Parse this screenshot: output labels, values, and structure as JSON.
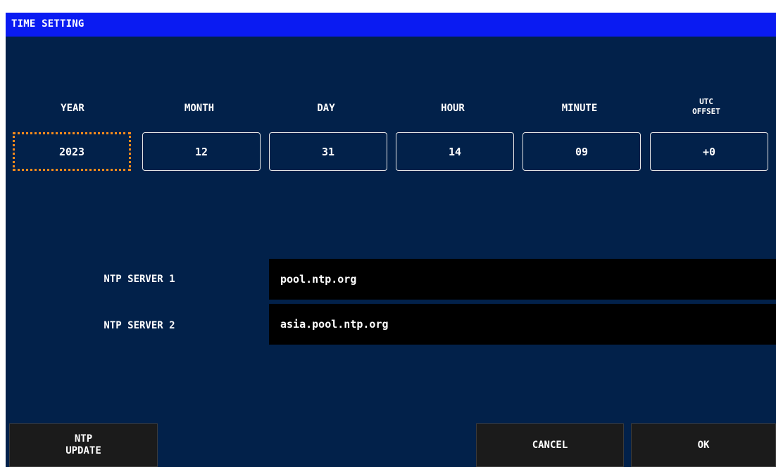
{
  "window": {
    "title": "TIME SETTING"
  },
  "fields": [
    {
      "label": "YEAR",
      "value": "2023"
    },
    {
      "label": "MONTH",
      "value": "12"
    },
    {
      "label": "DAY",
      "value": "31"
    },
    {
      "label": "HOUR",
      "value": "14"
    },
    {
      "label": "MINUTE",
      "value": "09"
    },
    {
      "label_line1": "UTC",
      "label_line2": "OFFSET",
      "value": "+0"
    }
  ],
  "ntp": {
    "server1_label": "NTP SERVER 1",
    "server1_value": "pool.ntp.org",
    "server2_label": "NTP SERVER 2",
    "server2_value": "asia.pool.ntp.org"
  },
  "buttons": {
    "ntp_update_line1": "NTP",
    "ntp_update_line2": "UPDATE",
    "cancel": "CANCEL",
    "ok": "OK"
  },
  "colors": {
    "background": "#02214a",
    "title_bar": "#0a1bf2",
    "focus_outline": "#ff8c1a",
    "input_background": "#000000",
    "button_background": "#1b1b1b"
  }
}
